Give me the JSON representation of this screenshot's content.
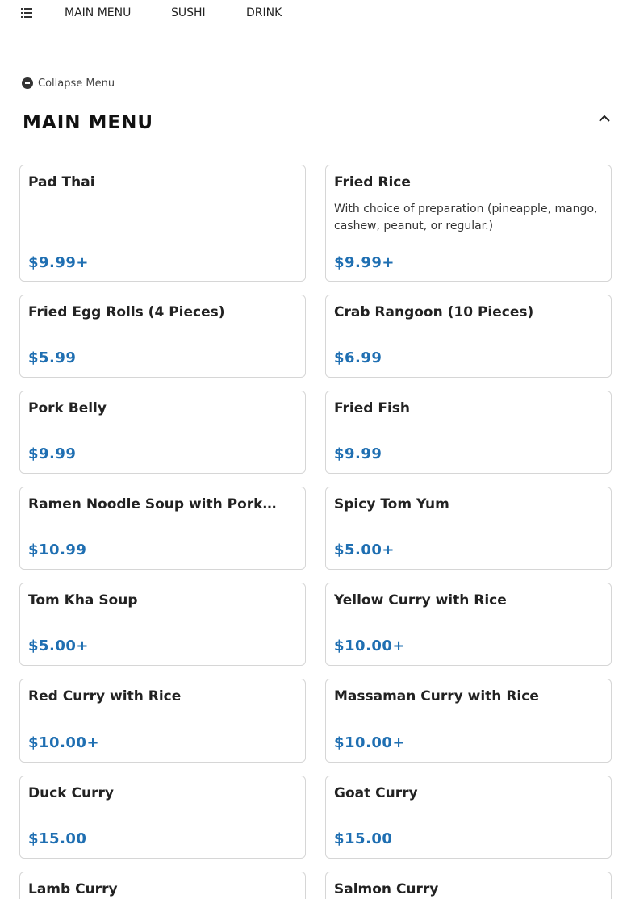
{
  "nav": {
    "items": [
      "MAIN MENU",
      "SUSHI",
      "DRINK"
    ]
  },
  "collapse_label": "Collapse Menu",
  "section": {
    "title": "MAIN MENU"
  },
  "items": [
    {
      "name": "Pad Thai",
      "description": "",
      "price": "$9.99+"
    },
    {
      "name": "Fried Rice",
      "description": "With choice of preparation (pineapple, mango, cashew, peanut, or regular.)",
      "price": "$9.99+"
    },
    {
      "name": "Fried Egg Rolls (4 Pieces)",
      "description": "",
      "price": "$5.99"
    },
    {
      "name": "Crab Rangoon (10 Pieces)",
      "description": "",
      "price": "$6.99"
    },
    {
      "name": "Pork Belly",
      "description": "",
      "price": "$9.99"
    },
    {
      "name": "Fried Fish",
      "description": "",
      "price": "$9.99"
    },
    {
      "name": "Ramen Noodle Soup with Pork…",
      "description": "",
      "price": "$10.99"
    },
    {
      "name": "Spicy Tom Yum",
      "description": "",
      "price": "$5.00+"
    },
    {
      "name": "Tom Kha Soup",
      "description": "",
      "price": "$5.00+"
    },
    {
      "name": "Yellow Curry with Rice",
      "description": "",
      "price": "$10.00+"
    },
    {
      "name": "Red Curry with Rice",
      "description": "",
      "price": "$10.00+"
    },
    {
      "name": "Massaman Curry with Rice",
      "description": "",
      "price": "$10.00+"
    },
    {
      "name": "Duck Curry",
      "description": "",
      "price": "$15.00"
    },
    {
      "name": "Goat Curry",
      "description": "",
      "price": "$15.00"
    },
    {
      "name": "Lamb Curry",
      "description": "",
      "price": ""
    },
    {
      "name": "Salmon Curry",
      "description": "",
      "price": ""
    }
  ],
  "colors": {
    "price": "#1f6fb2",
    "border": "#d6d6d6"
  }
}
